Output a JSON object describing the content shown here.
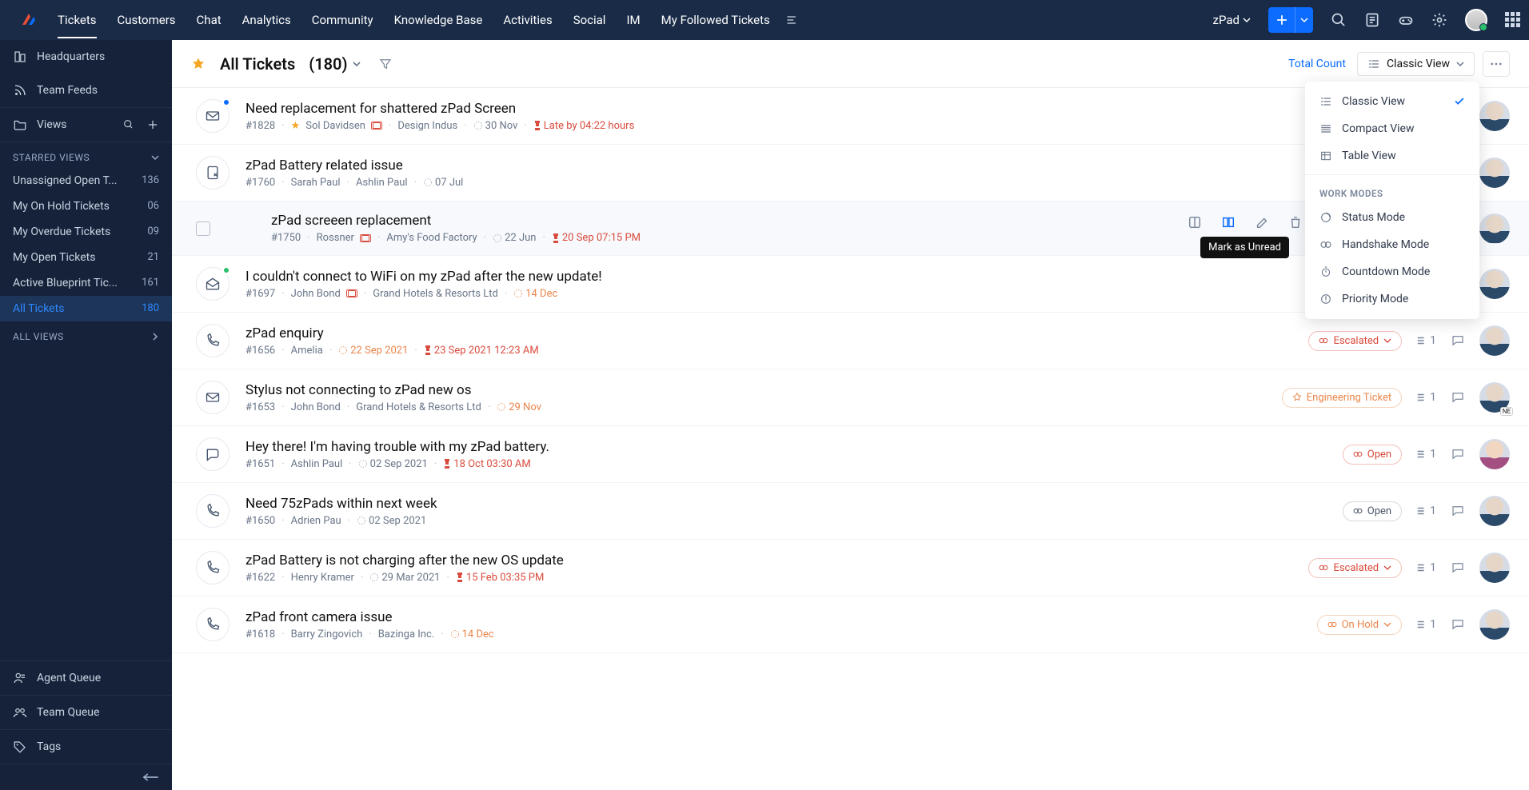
{
  "nav": {
    "items": [
      "Tickets",
      "Customers",
      "Chat",
      "Analytics",
      "Community",
      "Knowledge Base",
      "Activities",
      "Social",
      "IM",
      "My Followed Tickets"
    ],
    "department": "zPad"
  },
  "sidebar": {
    "headquarters": "Headquarters",
    "team_feeds": "Team Feeds",
    "views_label": "Views",
    "starred_hdr": "STARRED VIEWS",
    "all_views_hdr": "ALL VIEWS",
    "views": [
      {
        "label": "Unassigned Open T...",
        "count": "136"
      },
      {
        "label": "My On Hold Tickets",
        "count": "06"
      },
      {
        "label": "My Overdue Tickets",
        "count": "09"
      },
      {
        "label": "My Open Tickets",
        "count": "21"
      },
      {
        "label": "Active Blueprint Tic...",
        "count": "161"
      },
      {
        "label": "All Tickets",
        "count": "180"
      }
    ],
    "agent_queue": "Agent Queue",
    "team_queue": "Team Queue",
    "tags": "Tags"
  },
  "header": {
    "title": "All Tickets",
    "count": "(180)",
    "total_count": "Total Count",
    "view_selector": "Classic View"
  },
  "dropdown": {
    "views": [
      "Classic View",
      "Compact View",
      "Table View"
    ],
    "work_modes_hdr": "WORK MODES",
    "modes": [
      "Status Mode",
      "Handshake Mode",
      "Countdown Mode",
      "Priority Mode"
    ]
  },
  "row_tooltip": "Mark as Unread",
  "tickets": [
    {
      "title": "Need replacement for shattered zPad Screen",
      "id": "#1828",
      "contact": "Sol Davidsen",
      "vip": true,
      "card": true,
      "account": "Design Indus",
      "due": "30 Nov",
      "late": "Late by 04:22 hours",
      "channel": "mail"
    },
    {
      "title": "zPad Battery related issue",
      "id": "#1760",
      "contact": "Sarah Paul",
      "contact2": "Ashlin Paul",
      "due": "07 Jul",
      "channel": "draft"
    },
    {
      "title": "zPad screeen replacement",
      "id": "#1750",
      "contact": "Rossner",
      "card": true,
      "account": "Amy's Food Factory",
      "due": "22 Jun",
      "overdue": "20 Sep 07:15 PM",
      "channel": "mail",
      "hovered": true
    },
    {
      "title": "I couldn't connect to WiFi on my zPad after the new update!",
      "id": "#1697",
      "contact": "John Bond",
      "card": true,
      "account": "Grand Hotels & Resorts Ltd",
      "due_org": "14 Dec",
      "channel": "mail-open"
    },
    {
      "title": "zPad enquiry",
      "id": "#1656",
      "contact": "Amelia",
      "due_org": "22 Sep 2021",
      "overdue": "23 Sep 2021 12:23 AM",
      "channel": "phone",
      "badge": {
        "type": "esc",
        "label": "Escalated",
        "caret": true
      },
      "thread": "1",
      "comment": true
    },
    {
      "title": "Stylus not connecting to zPad new os",
      "id": "#1653",
      "contact": "John Bond",
      "account": "Grand Hotels & Resorts Ltd",
      "due_org": "29 Nov",
      "channel": "mail-closed",
      "badge": {
        "type": "eng",
        "label": "Engineering Ticket"
      },
      "thread": "1",
      "comment": true
    },
    {
      "title": "Hey there! I'm having trouble with my zPad battery.",
      "id": "#1651",
      "contact": "Ashlin Paul",
      "due": "02 Sep 2021",
      "overdue": "18 Oct 03:30 AM",
      "channel": "chat",
      "badge": {
        "type": "open-red",
        "label": "Open"
      },
      "thread": "1",
      "comment": true
    },
    {
      "title": "Need 75zPads within next week",
      "id": "#1650",
      "contact": "Adrien Pau",
      "due": "02 Sep 2021",
      "channel": "phone",
      "badge": {
        "type": "open",
        "label": "Open"
      },
      "thread": "1",
      "comment": true
    },
    {
      "title": "zPad Battery is not charging after the new OS update",
      "id": "#1622",
      "contact": "Henry Kramer",
      "due": "29 Mar 2021",
      "overdue": "15 Feb 03:35 PM",
      "channel": "phone",
      "badge": {
        "type": "esc",
        "label": "Escalated",
        "caret": true
      },
      "thread": "1",
      "comment": true
    },
    {
      "title": "zPad front camera issue",
      "id": "#1618",
      "contact": "Barry Zingovich",
      "account": "Bazinga Inc.",
      "due_org": "14 Dec",
      "channel": "phone",
      "badge": {
        "type": "hold",
        "label": "On Hold",
        "caret": true
      },
      "thread": "1",
      "comment": true
    }
  ]
}
